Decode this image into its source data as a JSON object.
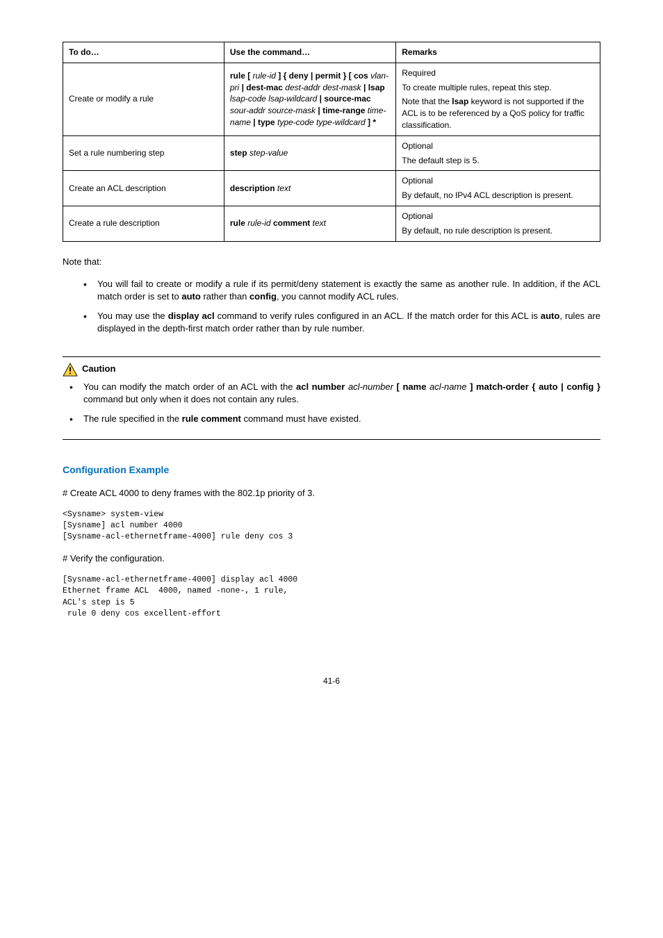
{
  "table": {
    "headers": [
      "To do…",
      "Use the command…",
      "Remarks"
    ],
    "rows": [
      {
        "todo": "Create or modify a rule",
        "cmd_parts": {
          "w1": "rule",
          "w2": "rule-id",
          "w3": "deny",
          "w4": "permit",
          "w5": "cos",
          "w6": "vlan-pri",
          "w7": "dest-mac",
          "w8": "dest-addr dest-mask",
          "w9": "lsap",
          "w10": "lsap-code lsap-wildcard",
          "w11": "source-mac",
          "w12": "sour-addr source-mask",
          "w13": "time-range",
          "w14": "time-name",
          "w15": "type",
          "w16": "type-code type-wildcard"
        },
        "remarks_p1": "Required",
        "remarks_p2": "To create multiple rules, repeat this step.",
        "remarks_p3a": "Note that the ",
        "remarks_p3b": "lsap",
        "remarks_p3c": " keyword is not supported if the ACL is to be referenced by a QoS policy for traffic classification."
      },
      {
        "todo": "Set a rule numbering step",
        "cmd_w1": "step",
        "cmd_w2": "step-value",
        "remarks_p1": "Optional",
        "remarks_p2": "The default step is 5."
      },
      {
        "todo": "Create an ACL description",
        "cmd_w1": "description",
        "cmd_w2": "text",
        "remarks_p1": "Optional",
        "remarks_p2": "By default, no IPv4 ACL description is present."
      },
      {
        "todo": "Create a rule description",
        "cmd_w1": "rule",
        "cmd_w2": "rule-id",
        "cmd_w3": "comment",
        "cmd_w4": "text",
        "remarks_p1": "Optional",
        "remarks_p2": "By default, no rule description is present."
      }
    ]
  },
  "note_intro": "Note that:",
  "note_items": [
    {
      "t1": "You will fail to create or modify a rule if its permit/deny statement is exactly the same as another rule. In addition, if the ACL match order is set to ",
      "b1": "auto",
      "t2": " rather than ",
      "b2": "config",
      "t3": ", you cannot modify ACL rules."
    },
    {
      "t1": "You may use the ",
      "b1": "display acl",
      "t2": " command to verify rules configured in an ACL. If the match order for this ACL is ",
      "b2": "auto",
      "t3": ", rules are displayed in the depth-first match order rather than by rule number."
    }
  ],
  "caution": {
    "label": "Caution",
    "items": [
      {
        "t1": "You can modify the match order of an ACL with the ",
        "seg_b1": "acl number ",
        "seg_i1": "acl-number",
        "seg_b2": " [ ",
        "seg_b3": "name ",
        "seg_i2": "acl-name",
        "seg_b4": " ] match-order",
        "seg_b5": " { ",
        "seg_b6": "auto",
        "seg_b7": " | ",
        "seg_b8": "config",
        "seg_b9": " }",
        "t2": " command but only when it does not contain any rules."
      },
      {
        "t1": "The rule specified in the ",
        "b1": "rule comment",
        "t2": " command must have existed."
      }
    ]
  },
  "example": {
    "heading": "Configuration Example",
    "step1": "# Create ACL 4000 to deny frames with the 802.1p priority of 3.",
    "code1": "<Sysname> system-view\n[Sysname] acl number 4000\n[Sysname-acl-ethernetframe-4000] rule deny cos 3",
    "step2": "# Verify the configuration.",
    "code2": "[Sysname-acl-ethernetframe-4000] display acl 4000\nEthernet frame ACL  4000, named -none-, 1 rule,\nACL's step is 5\n rule 0 deny cos excellent-effort"
  },
  "page": "41-6"
}
